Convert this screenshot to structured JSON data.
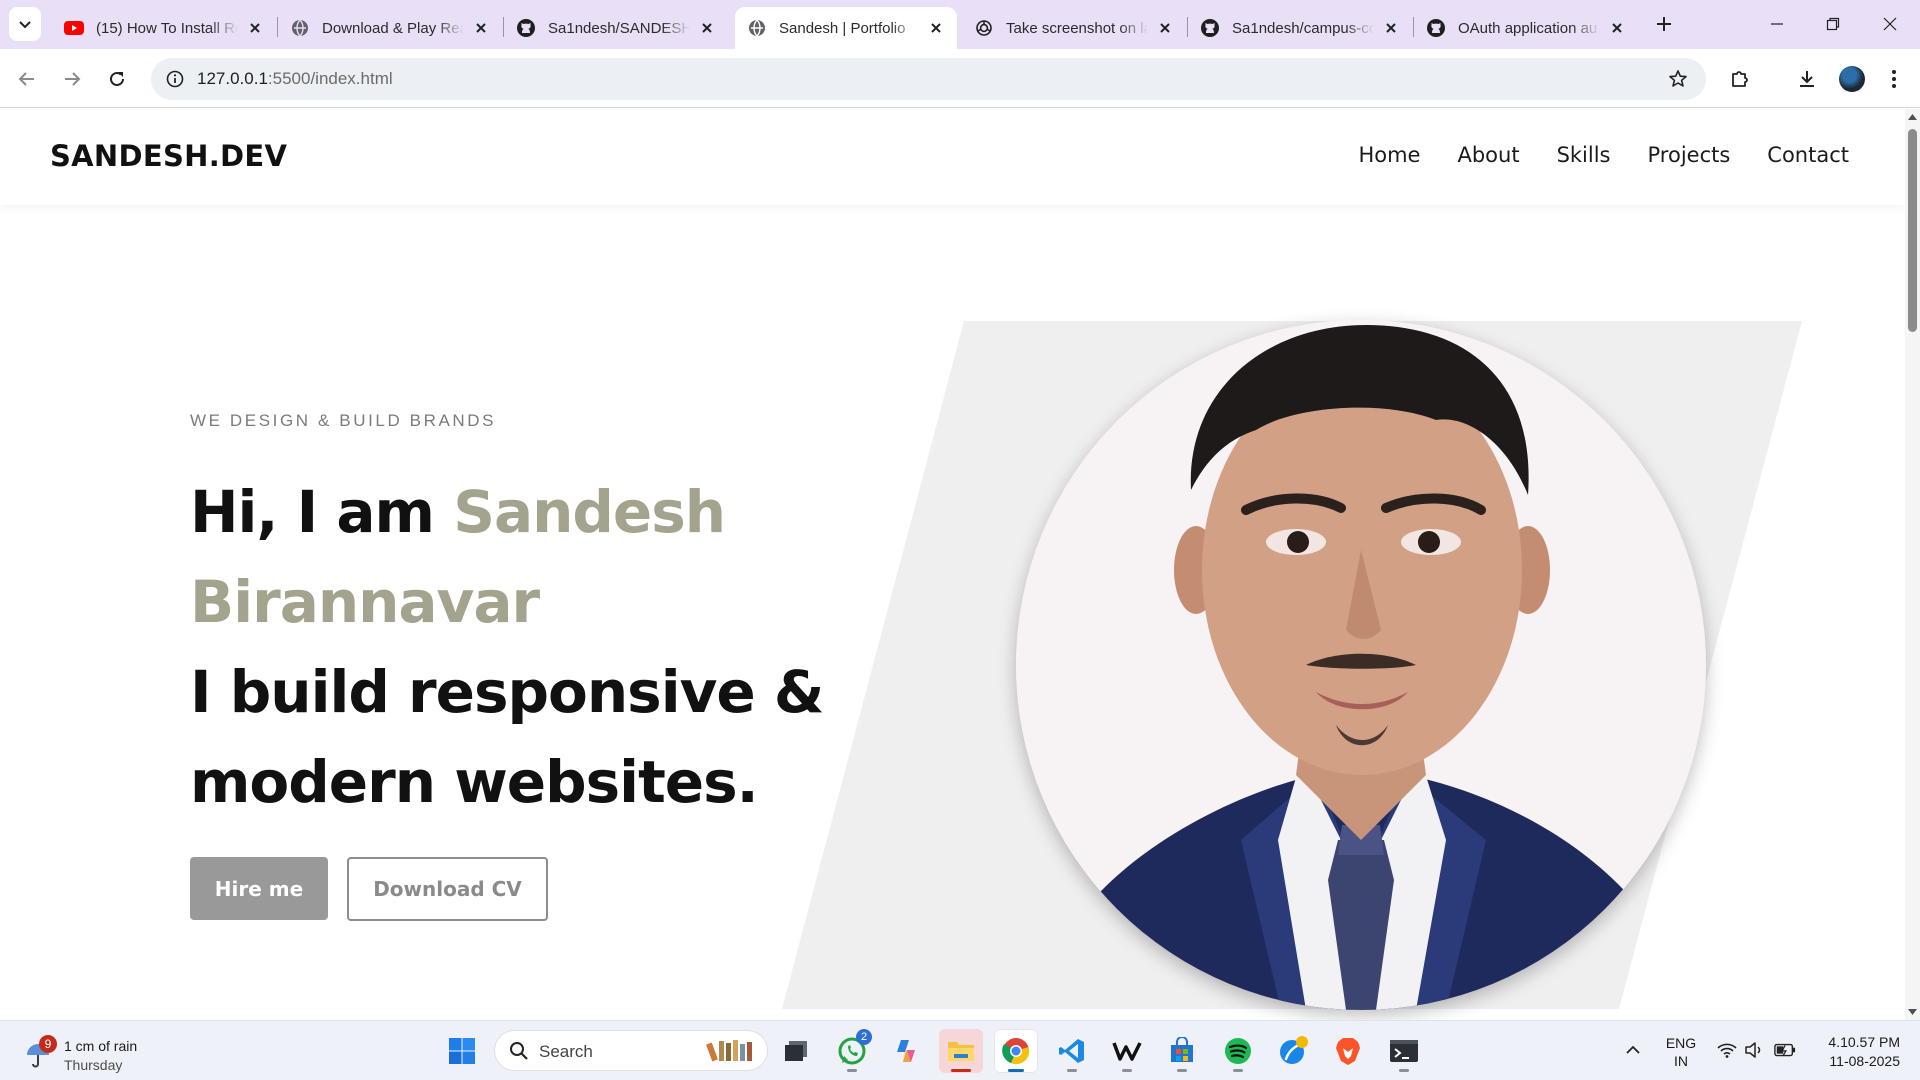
{
  "browser": {
    "tabs": [
      {
        "title": "(15) How To Install Re",
        "icon": "youtube-icon",
        "active": false
      },
      {
        "title": "Download & Play Rea",
        "icon": "globe-icon",
        "active": false
      },
      {
        "title": "Sa1ndesh/SANDESH-",
        "icon": "github-icon",
        "active": false
      },
      {
        "title": "Sandesh | Portfolio",
        "icon": "globe-icon",
        "active": true
      },
      {
        "title": "Take screenshot on la",
        "icon": "chatgpt-icon",
        "active": false
      },
      {
        "title": "Sa1ndesh/campus-co",
        "icon": "github-icon",
        "active": false
      },
      {
        "title": "OAuth application au",
        "icon": "github-icon",
        "active": false
      }
    ],
    "url_host": "127.0.0.1",
    "url_path": ":5500/index.html"
  },
  "site": {
    "logo": "SANDESH.DEV",
    "nav": [
      "Home",
      "About",
      "Skills",
      "Projects",
      "Contact"
    ],
    "hero": {
      "eyebrow": "WE DESIGN & BUILD BRANDS",
      "greeting": "Hi, I am ",
      "name": "Sandesh Birannavar",
      "tagline": "I build responsive & modern websites.",
      "hire_label": "Hire me",
      "cv_label": "Download CV"
    },
    "colors": {
      "accent": "#a4a38e",
      "text": "#111111",
      "panel": "#efefef"
    }
  },
  "taskbar": {
    "weather_badge": "9",
    "weather_text": "1 cm of rain",
    "weather_day": "Thursday",
    "search_label": "Search",
    "whatsapp_badge": "2",
    "lang_line1": "ENG",
    "lang_line2": "IN",
    "time": "4.10.57 PM",
    "date": "11-08-2025"
  }
}
